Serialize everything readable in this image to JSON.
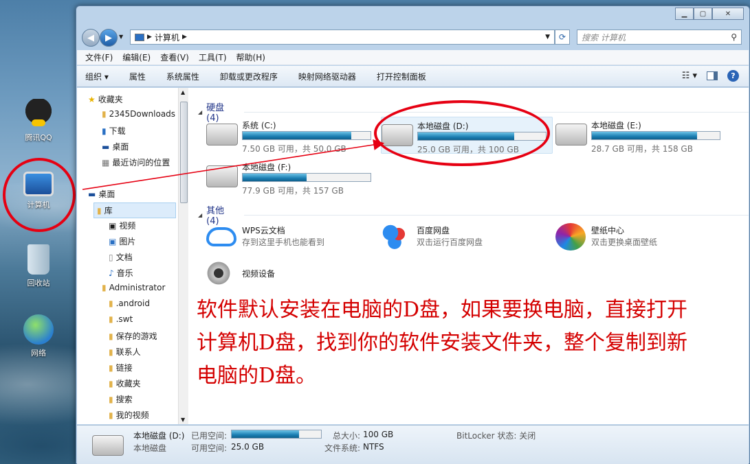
{
  "desktop": {
    "icons": [
      {
        "label": "腾讯QQ"
      },
      {
        "label": "计算机"
      },
      {
        "label": "回收站"
      },
      {
        "label": "网络"
      }
    ]
  },
  "window": {
    "address": {
      "path": [
        "计算机"
      ]
    },
    "search_placeholder": "搜索 计算机",
    "menu": [
      "文件(F)",
      "编辑(E)",
      "查看(V)",
      "工具(T)",
      "帮助(H)"
    ],
    "toolbar": [
      "组织 ▾",
      "属性",
      "系统属性",
      "卸载或更改程序",
      "映射网络驱动器",
      "打开控制面板"
    ]
  },
  "nav_tree": [
    {
      "label": "收藏夹",
      "icon": "star-icon"
    },
    {
      "label": "2345Downloads",
      "icon": "folder-icon"
    },
    {
      "label": "下载",
      "icon": "download-folder-icon"
    },
    {
      "label": "桌面",
      "icon": "desktop-icon"
    },
    {
      "label": "最近访问的位置",
      "icon": "recent-icon"
    },
    {
      "label": "桌面",
      "icon": "desktop-icon"
    },
    {
      "label": "库",
      "icon": "library-icon"
    },
    {
      "label": "视频",
      "icon": "video-icon"
    },
    {
      "label": "图片",
      "icon": "picture-icon"
    },
    {
      "label": "文档",
      "icon": "document-icon"
    },
    {
      "label": "音乐",
      "icon": "music-icon"
    },
    {
      "label": "Administrator",
      "icon": "user-folder-icon"
    },
    {
      "label": ".android",
      "icon": "folder-icon"
    },
    {
      "label": ".swt",
      "icon": "folder-icon"
    },
    {
      "label": "保存的游戏",
      "icon": "games-icon"
    },
    {
      "label": "联系人",
      "icon": "contacts-icon"
    },
    {
      "label": "链接",
      "icon": "links-icon"
    },
    {
      "label": "收藏夹",
      "icon": "favorites-folder-icon"
    },
    {
      "label": "搜索",
      "icon": "search-folder-icon"
    },
    {
      "label": "我的视频",
      "icon": "video-folder-icon"
    }
  ],
  "groups": {
    "hard_disks": "硬盘 (4)",
    "other": "其他 (4)"
  },
  "drives": [
    {
      "name": "系统 (C:)",
      "size": "7.50 GB 可用，共 50.0 GB",
      "used_fraction": 0.85
    },
    {
      "name": "本地磁盘 (D:)",
      "size": "25.0 GB 可用，共 100 GB",
      "used_fraction": 0.75
    },
    {
      "name": "本地磁盘 (E:)",
      "size": "28.7 GB 可用，共 158 GB",
      "used_fraction": 0.82
    },
    {
      "name": "本地磁盘 (F:)",
      "size": "77.9 GB 可用，共 157 GB",
      "used_fraction": 0.5
    }
  ],
  "others": [
    {
      "name": "WPS云文档",
      "desc": "存到这里手机也能看到"
    },
    {
      "name": "百度网盘",
      "desc": "双击运行百度网盘"
    },
    {
      "name": "壁纸中心",
      "desc": "双击更换桌面壁纸"
    },
    {
      "name": "视频设备",
      "desc": ""
    }
  ],
  "annotation": "软件默认安装在电脑的D盘，如果要换电脑，直接打开计算机D盘，找到你的软件安装文件夹，整个复制到新电脑的D盘。",
  "status": {
    "drive_name": "本地磁盘 (D:)",
    "drive_type": "本地磁盘",
    "used_label": "已用空间:",
    "used_fraction": 0.75,
    "free_label": "可用空间:",
    "free_value": "25.0 GB",
    "total_label": "总大小:",
    "total_value": "100 GB",
    "fs_label": "文件系统:",
    "fs_value": "NTFS",
    "bitlocker": "BitLocker 状态: 关闭"
  }
}
